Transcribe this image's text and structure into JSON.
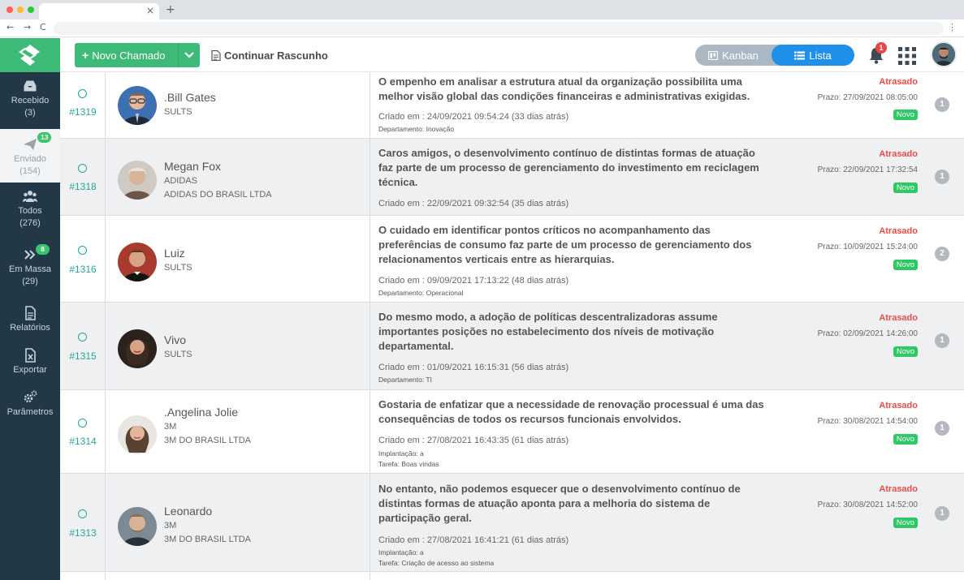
{
  "browser": {
    "tab_close": "×",
    "new_tab": "+",
    "nav": {
      "back": "←",
      "forward": "→",
      "reload": "C"
    },
    "menu": "⋮"
  },
  "colors": {
    "brand_green": "#3dba78",
    "sidebar": "#223847",
    "accent_blue": "#1e90ea",
    "late_red": "#ee4a4a",
    "new_green": "#2ec964",
    "ticket_teal": "#26a69a"
  },
  "sidebar": {
    "items": [
      {
        "label": "Recebido",
        "count": "(3)",
        "icon": "inbox-icon"
      },
      {
        "label": "Enviado",
        "count": "(154)",
        "badge": "13",
        "icon": "paper-plane-icon"
      },
      {
        "label": "Todos",
        "count": "(276)",
        "icon": "users-icon"
      },
      {
        "label": "Em Massa",
        "count": "(29)",
        "badge": "8",
        "icon": "double-chevron-icon"
      },
      {
        "label": "Relatórios",
        "icon": "report-icon"
      },
      {
        "label": "Exportar",
        "icon": "excel-icon"
      },
      {
        "label": "Parâmetros",
        "icon": "gears-icon"
      }
    ]
  },
  "toolbar": {
    "new_ticket_label": "Novo Chamado",
    "draft_label": "Continuar Rascunho",
    "view_kanban": "Kanban",
    "view_list": "Lista",
    "notification_count": "1"
  },
  "tickets": [
    {
      "id": "#1319",
      "name": ".Bill Gates",
      "company": "SULTS",
      "company_full": "",
      "subject": "O empenho em analisar a estrutura atual da organização possibilita uma melhor visão global das condições financeiras e administrativas exigidas.",
      "created": "Criado em : 24/09/2021 09:54:24 (33 dias atrás)",
      "meta1": "Departamento: Inovação",
      "meta2": "",
      "status": "Atrasado",
      "deadline": "Prazo: 27/09/2021 08:05:00",
      "tag": "Novo",
      "comments": "1"
    },
    {
      "id": "#1318",
      "name": "Megan Fox",
      "company": "ADIDAS",
      "company_full": "ADIDAS DO BRASIL LTDA",
      "subject": "Caros amigos, o desenvolvimento contínuo de distintas formas de atuação faz parte de um processo de gerenciamento do investimento em reciclagem técnica.",
      "created": "Criado em : 22/09/2021 09:32:54 (35 dias atrás)",
      "meta1": "",
      "meta2": "",
      "status": "Atrasado",
      "deadline": "Prazo: 22/09/2021 17:32:54",
      "tag": "Novo",
      "comments": "1"
    },
    {
      "id": "#1316",
      "name": "Luiz",
      "company": "SULTS",
      "company_full": "",
      "subject": "O cuidado em identificar pontos críticos no acompanhamento das preferências de consumo faz parte de um processo de gerenciamento dos relacionamentos verticais entre as hierarquias.",
      "created": "Criado em : 09/09/2021 17:13:22 (48 dias atrás)",
      "meta1": "Departamento: Operacional",
      "meta2": "",
      "status": "Atrasado",
      "deadline": "Prazo: 10/09/2021 15:24:00",
      "tag": "Novo",
      "comments": "2"
    },
    {
      "id": "#1315",
      "name": "Vivo",
      "company": "SULTS",
      "company_full": "",
      "subject": "Do mesmo modo, a adoção de políticas descentralizadoras assume importantes posições no estabelecimento dos níveis de motivação departamental.",
      "created": "Criado em : 01/09/2021 16:15:31 (56 dias atrás)",
      "meta1": "Departamento: TI",
      "meta2": "",
      "status": "Atrasado",
      "deadline": "Prazo: 02/09/2021 14:26:00",
      "tag": "Novo",
      "comments": "1"
    },
    {
      "id": "#1314",
      "name": ".Angelina Jolie",
      "company": "3M",
      "company_full": "3M DO BRASIL LTDA",
      "subject": "Gostaria de enfatizar que a necessidade de renovação processual é uma das consequências de todos os recursos funcionais envolvidos.",
      "created": "Criado em : 27/08/2021 16:43:35 (61 dias atrás)",
      "meta1": "Implantação: a",
      "meta2": "Tarefa: Boas vindas",
      "status": "Atrasado",
      "deadline": "Prazo: 30/08/2021 14:54:00",
      "tag": "Novo",
      "comments": "1"
    },
    {
      "id": "#1313",
      "name": "Leonardo",
      "company": "3M",
      "company_full": "3M DO BRASIL LTDA",
      "subject": "No entanto, não podemos esquecer que o desenvolvimento contínuo de distintas formas de atuação aponta para a melhoria do sistema de participação geral.",
      "created": "Criado em : 27/08/2021 16:41:21 (61 dias atrás)",
      "meta1": "Implantação: a",
      "meta2": "Tarefa: Criação de acesso ao sistema",
      "status": "Atrasado",
      "deadline": "Prazo: 30/08/2021 14:52:00",
      "tag": "Novo",
      "comments": "1"
    }
  ]
}
